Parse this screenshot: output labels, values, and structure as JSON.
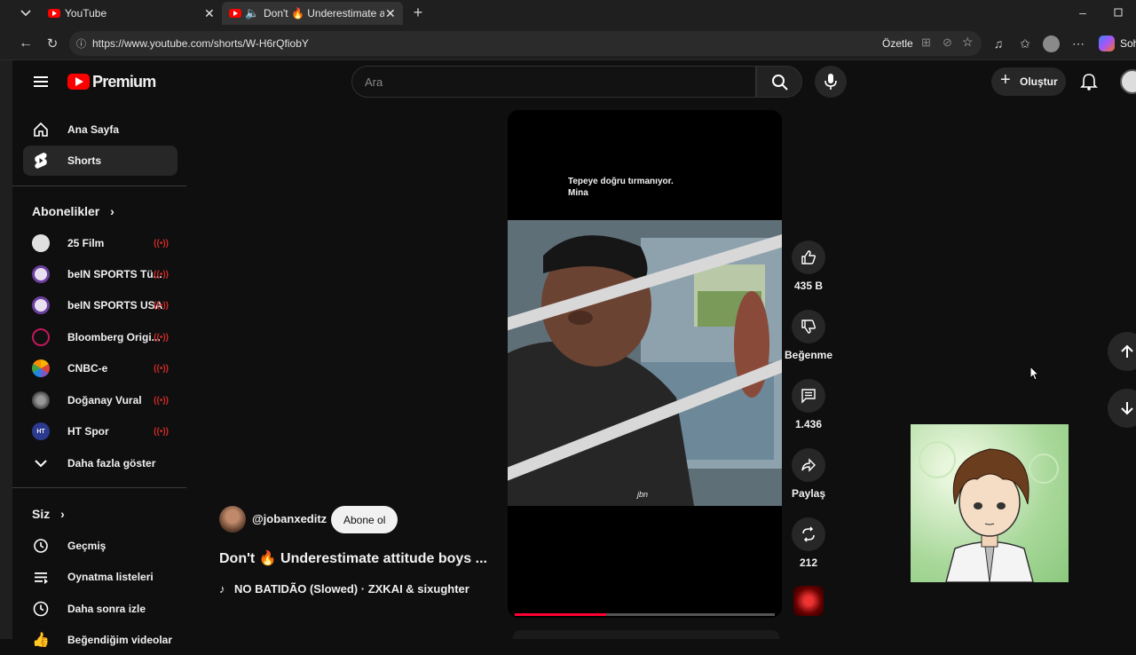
{
  "browser": {
    "tabs": [
      {
        "title": "YouTube"
      },
      {
        "title": "Don't 🔥 Underestimate attitu"
      }
    ],
    "url": "https://www.youtube.com/shorts/W-H6rQfiobY",
    "ozetle": "Özetle",
    "copilot_label": "Soh"
  },
  "masthead": {
    "logo_text": "Premium",
    "search_placeholder": "Ara",
    "create_label": "Oluştur"
  },
  "sidebar": {
    "main": [
      {
        "label": "Ana Sayfa",
        "icon": "home-icon"
      },
      {
        "label": "Shorts",
        "icon": "shorts-icon"
      }
    ],
    "subs_title": "Abonelikler",
    "subscriptions": [
      {
        "label": "25 Film",
        "color": "#d8d8d8"
      },
      {
        "label": "beIN SPORTS Tü...",
        "color": "#6a3f9e"
      },
      {
        "label": "beIN SPORTS USA",
        "color": "#6a3f9e"
      },
      {
        "label": "Bloomberg Origi...",
        "color": "#222"
      },
      {
        "label": "CNBC-e",
        "color": "#ffffff"
      },
      {
        "label": "Doğanay Vural",
        "color": "#777"
      },
      {
        "label": "HT Spor",
        "color": "#2b3a8f"
      }
    ],
    "more_label": "Daha fazla göster",
    "you_title": "Siz",
    "you_items": [
      {
        "label": "Geçmiş"
      },
      {
        "label": "Oynatma listeleri"
      },
      {
        "label": "Daha sonra izle"
      },
      {
        "label": "Beğendiğim videolar"
      }
    ]
  },
  "short": {
    "caption_line1": "Tepeye doğru tırmanıyor.",
    "caption_line2": "Mina",
    "watermark": "jbn",
    "channel": "@jobanxeditz",
    "subscribe_label": "Abone ol",
    "title": "Don't 🔥 Underestimate attitude boys ...",
    "music": "NO BATIDÃO (Slowed) · ZXKAI & sixughter",
    "progress": 0.35
  },
  "actions": {
    "likes": "435 B",
    "dislike_label": "Beğenme",
    "comments": "1.436",
    "share_label": "Paylaş",
    "remix": "212"
  }
}
